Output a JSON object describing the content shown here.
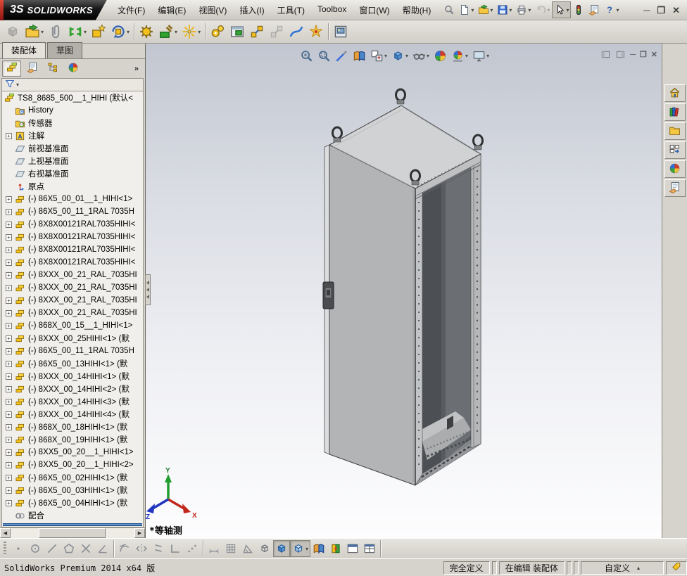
{
  "title_bar": {
    "logo": {
      "mark": "3S",
      "text": "SOLIDWORKS"
    },
    "menus": [
      "文件(F)",
      "编辑(E)",
      "视图(V)",
      "插入(I)",
      "工具(T)",
      "Toolbox",
      "窗口(W)",
      "帮助(H)"
    ],
    "quick_buttons": [
      {
        "name": "search",
        "icon": "search"
      },
      {
        "name": "new-document",
        "icon": "new-doc",
        "caret": true
      },
      {
        "name": "open-document",
        "icon": "open-doc",
        "caret": true
      },
      {
        "name": "save",
        "icon": "save",
        "caret": true
      },
      {
        "name": "print",
        "icon": "print",
        "caret": true
      },
      {
        "name": "undo",
        "icon": "undo",
        "caret": true,
        "disabled": true
      },
      {
        "name": "select",
        "icon": "select-cursor",
        "caret": true,
        "boxed": true
      },
      {
        "name": "rebuild",
        "icon": "rebuild-light"
      },
      {
        "name": "options",
        "icon": "options"
      },
      {
        "name": "help",
        "icon": "help",
        "caret": true
      }
    ],
    "window_controls": [
      {
        "name": "minimize-window",
        "glyph": "─"
      },
      {
        "name": "restore-window",
        "glyph": "❐"
      },
      {
        "name": "close-window",
        "glyph": "✕"
      }
    ]
  },
  "assembly_toolbar": [
    {
      "name": "insert-component",
      "icon": "cube-shaded",
      "disabled": true
    },
    {
      "name": "open-part",
      "icon": "open-doc",
      "caret": true
    },
    {
      "name": "attach-document",
      "icon": "paperclip"
    },
    {
      "name": "mate",
      "icon": "mate",
      "caret": true
    },
    {
      "name": "smart-fasteners",
      "icon": "smart-fastener"
    },
    {
      "name": "rotate-component",
      "icon": "rotate",
      "caret": true
    },
    {
      "sep": true
    },
    {
      "name": "move-component",
      "icon": "gear"
    },
    {
      "name": "assembly-tools",
      "icon": "hammer",
      "caret": true
    },
    {
      "name": "reference-geometry",
      "icon": "sparkle",
      "caret": true
    },
    {
      "sep": true
    },
    {
      "name": "assembly-features",
      "icon": "gears2"
    },
    {
      "name": "new-window-preview",
      "icon": "window-green"
    },
    {
      "name": "exploded-view",
      "icon": "exploded"
    },
    {
      "name": "explode-line-sketch",
      "icon": "exploded",
      "disabled": true
    },
    {
      "name": "route-line",
      "icon": "curve-line"
    },
    {
      "name": "motion-study",
      "icon": "motion-burst"
    },
    {
      "sep": true
    },
    {
      "name": "capture-image",
      "icon": "image-frame"
    }
  ],
  "left_panel": {
    "document_tabs": [
      {
        "label": "装配体",
        "active": true
      },
      {
        "label": "草图",
        "active": false
      }
    ],
    "manager_tabs": [
      {
        "name": "featuremanager-tree",
        "icon": "assembly",
        "pressed": true
      },
      {
        "name": "propertymanager",
        "icon": "options"
      },
      {
        "name": "configurationmanager",
        "icon": "configs"
      },
      {
        "name": "displaymanager",
        "icon": "ball"
      }
    ],
    "overflow_label": "»",
    "tree": {
      "root": {
        "icon": "assembly",
        "label": "TS8_8685_500__1_HIHI  (默认<"
      },
      "items": [
        {
          "icon": "folder-history",
          "label": "History"
        },
        {
          "icon": "folder-sensor",
          "label": "传感器"
        },
        {
          "expand": true,
          "icon": "annotation",
          "label": "注解"
        },
        {
          "icon": "plane",
          "label": "前视基准面"
        },
        {
          "icon": "plane",
          "label": "上视基准面"
        },
        {
          "icon": "plane",
          "label": "右视基准面"
        },
        {
          "icon": "origin",
          "label": "原点"
        },
        {
          "expand": true,
          "icon": "part",
          "label": "(-) 86X5_00_01__1_HIHI<1>"
        },
        {
          "expand": true,
          "icon": "part",
          "label": "(-) 86X5_00_11_1RAL 7035H"
        },
        {
          "expand": true,
          "icon": "part",
          "label": "(-) 8X8X00121RAL7035HIHI<"
        },
        {
          "expand": true,
          "icon": "part",
          "label": "(-) 8X8X00121RAL7035HIHI<"
        },
        {
          "expand": true,
          "icon": "part",
          "label": "(-) 8X8X00121RAL7035HIHI<"
        },
        {
          "expand": true,
          "icon": "part",
          "label": "(-) 8X8X00121RAL7035HIHI<"
        },
        {
          "expand": true,
          "icon": "part",
          "label": "(-) 8XXX_00_21_RAL_7035HI"
        },
        {
          "expand": true,
          "icon": "part",
          "label": "(-) 8XXX_00_21_RAL_7035HI"
        },
        {
          "expand": true,
          "icon": "part",
          "label": "(-) 8XXX_00_21_RAL_7035HI"
        },
        {
          "expand": true,
          "icon": "part",
          "label": "(-) 8XXX_00_21_RAL_7035HI"
        },
        {
          "expand": true,
          "icon": "part",
          "label": "(-) 868X_00_15__1_HIHI<1>"
        },
        {
          "expand": true,
          "icon": "part",
          "label": "(-) 8XXX_00_25HIHI<1> (默"
        },
        {
          "expand": true,
          "icon": "part",
          "label": "(-) 86X5_00_11_1RAL 7035H"
        },
        {
          "expand": true,
          "icon": "part",
          "label": "(-) 86X5_00_13HIHI<1> (默"
        },
        {
          "expand": true,
          "icon": "part",
          "label": "(-) 8XXX_00_14HIHI<1> (默"
        },
        {
          "expand": true,
          "icon": "part",
          "label": "(-) 8XXX_00_14HIHI<2> (默"
        },
        {
          "expand": true,
          "icon": "part",
          "label": "(-) 8XXX_00_14HIHI<3> (默"
        },
        {
          "expand": true,
          "icon": "part",
          "label": "(-) 8XXX_00_14HIHI<4> (默"
        },
        {
          "expand": true,
          "icon": "part",
          "label": "(-) 868X_00_18HIHI<1> (默"
        },
        {
          "expand": true,
          "icon": "part",
          "label": "(-) 868X_00_19HIHI<1> (默"
        },
        {
          "expand": true,
          "icon": "part",
          "label": "(-) 8XX5_00_20__1_HIHI<1>"
        },
        {
          "expand": true,
          "icon": "part",
          "label": "(-) 8XX5_00_20__1_HIHI<2>"
        },
        {
          "expand": true,
          "icon": "part",
          "label": "(-) 86X5_00_02HIHI<1> (默"
        },
        {
          "expand": true,
          "icon": "part",
          "label": "(-) 86X5_00_03HIHI<1> (默"
        },
        {
          "expand": true,
          "icon": "part",
          "label": "(-) 86X5_00_04HIHI<1> (默"
        },
        {
          "icon": "mates",
          "label": "配合"
        }
      ]
    }
  },
  "viewport": {
    "headsup": [
      {
        "name": "zoom-to-fit",
        "icon": "zoom-fit"
      },
      {
        "name": "zoom-to-area",
        "icon": "zoom-area"
      },
      {
        "name": "view-selector",
        "icon": "magic-pen"
      },
      {
        "name": "section-view",
        "icon": "section-book"
      },
      {
        "name": "view-orientation",
        "icon": "view-orient",
        "caret": true
      },
      {
        "name": "display-style",
        "icon": "cube-shaded",
        "caret": true
      },
      {
        "name": "hide-show-items",
        "icon": "glasses",
        "caret": true
      },
      {
        "name": "edit-appearance",
        "icon": "ball"
      },
      {
        "name": "apply-scene",
        "icon": "scene-ball",
        "caret": true
      },
      {
        "name": "view-settings",
        "icon": "monitor",
        "caret": true
      }
    ],
    "child_controls": [
      {
        "name": "toggle-left-pane",
        "icon": "pane-left"
      },
      {
        "name": "toggle-right-pane",
        "icon": "pane-right"
      },
      {
        "name": "minimize-document",
        "glyph": "─"
      },
      {
        "name": "restore-document",
        "glyph": "❐"
      },
      {
        "name": "close-document",
        "glyph": "✕"
      }
    ],
    "view_label": "*等轴测",
    "triad_labels": {
      "x": "X",
      "y": "Y",
      "z": "Z"
    }
  },
  "task_pane": [
    {
      "name": "solidworks-resources",
      "icon": "home"
    },
    {
      "name": "design-library",
      "icon": "books"
    },
    {
      "name": "file-explorer",
      "icon": "folder"
    },
    {
      "name": "view-palette",
      "icon": "view-palette"
    },
    {
      "name": "appearances-scenes",
      "icon": "ball"
    },
    {
      "name": "custom-properties",
      "icon": "custom-props"
    }
  ],
  "bottom_toolbar": [
    {
      "name": "sketch-point",
      "icon": "sk-point"
    },
    {
      "name": "sketch-circle",
      "icon": "sk-circle"
    },
    {
      "name": "sketch-line",
      "icon": "sk-line"
    },
    {
      "name": "sketch-polygon",
      "icon": "sk-polygon"
    },
    {
      "name": "trim-entities",
      "icon": "sk-trim"
    },
    {
      "name": "sketch-chamfer",
      "icon": "sk-angle-line"
    },
    {
      "sep": true
    },
    {
      "name": "tangent-arc",
      "icon": "sk-tangent"
    },
    {
      "name": "mirror-entities",
      "icon": "sk-mirror"
    },
    {
      "name": "parallel-relation",
      "icon": "sk-parallel"
    },
    {
      "name": "corner-rectangle",
      "icon": "sk-corner"
    },
    {
      "name": "spline-points",
      "icon": "sk-points"
    },
    {
      "sep": true
    },
    {
      "name": "smart-dimension",
      "icon": "sk-dim"
    },
    {
      "name": "grid-snap",
      "icon": "sk-grid"
    },
    {
      "name": "angle-snap",
      "icon": "sk-angle"
    },
    {
      "name": "wireframe-display",
      "icon": "cube-wire"
    },
    {
      "name": "shaded-display",
      "icon": "cube-shaded",
      "pressed": true
    },
    {
      "name": "shaded-with-edges-display",
      "icon": "cube-edges",
      "pressed": true,
      "caret": true
    },
    {
      "name": "section-view-toggle",
      "icon": "section-book"
    },
    {
      "name": "interference-detection",
      "icon": "interference"
    },
    {
      "name": "split-window",
      "icon": "panel-split"
    },
    {
      "name": "viewport-layout",
      "icon": "panel-grid"
    },
    {
      "sep": true
    }
  ],
  "status_bar": {
    "product": "SolidWorks Premium 2014 x64 版",
    "define_state": "完全定义",
    "edit_state": "在编辑 装配体",
    "custom_label": "自定义",
    "custom_caret": "▴"
  }
}
